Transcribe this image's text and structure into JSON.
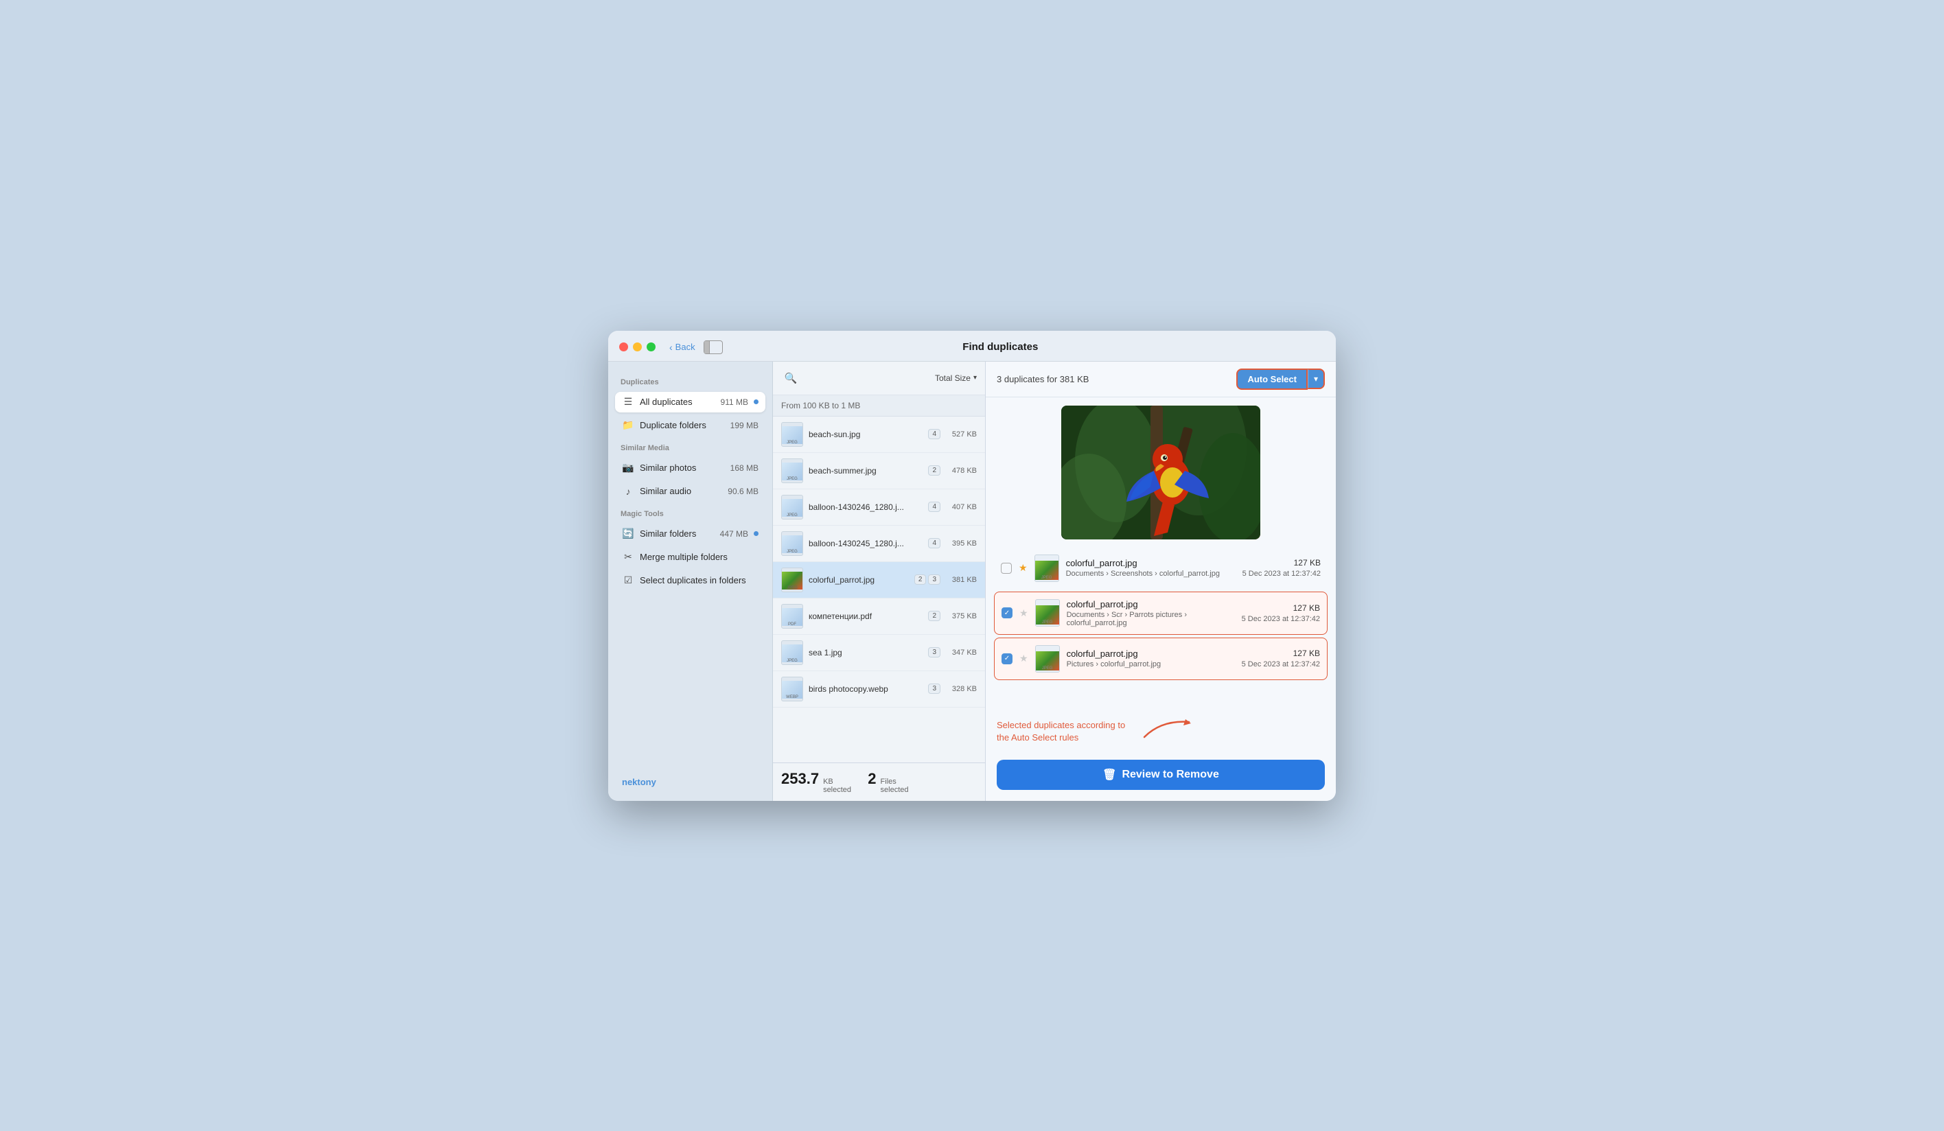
{
  "window": {
    "title": "Find duplicates",
    "back_label": "Back"
  },
  "sidebar": {
    "duplicates_section": "Duplicates",
    "all_duplicates": "All duplicates",
    "all_duplicates_size": "911 MB",
    "duplicate_folders": "Duplicate folders",
    "duplicate_folders_size": "199 MB",
    "similar_media_section": "Similar Media",
    "similar_photos": "Similar photos",
    "similar_photos_size": "168 MB",
    "similar_audio": "Similar audio",
    "similar_audio_size": "90.6 MB",
    "magic_tools_section": "Magic Tools",
    "similar_folders": "Similar folders",
    "similar_folders_size": "447 MB",
    "merge_folders": "Merge multiple folders",
    "select_dups_label": "Select duplicates in folders",
    "logo": "nektony"
  },
  "file_panel": {
    "sort_label": "Total Size",
    "range_label": "From 100 KB to 1 MB",
    "files": [
      {
        "name": "beach-sun.jpg",
        "badge1": "4",
        "size": "527 KB"
      },
      {
        "name": "beach-summer.jpg",
        "badge1": "2",
        "size": "478 KB"
      },
      {
        "name": "balloon-1430246_1280.j...",
        "badge1": "4",
        "size": "407 KB"
      },
      {
        "name": "balloon-1430245_1280.j...",
        "badge1": "4",
        "size": "395 KB"
      },
      {
        "name": "colorful_parrot.jpg",
        "badge1": "2",
        "badge2": "3",
        "size": "381 KB",
        "selected": true
      },
      {
        "name": "компетенции.pdf",
        "badge1": "2",
        "size": "375 KB"
      },
      {
        "name": "sea 1.jpg",
        "badge1": "3",
        "size": "347 KB"
      },
      {
        "name": "birds photocopy.webp",
        "badge1": "3",
        "size": "328 KB"
      }
    ],
    "footer_kb": "253.7",
    "footer_kb_unit": "KB",
    "footer_kb_sublabel": "selected",
    "footer_files": "2",
    "footer_files_unit": "Files",
    "footer_files_sublabel": "selected"
  },
  "detail_panel": {
    "dup_count_text": "3 duplicates for 381 KB",
    "auto_select_label": "Auto Select",
    "entries": [
      {
        "checked": false,
        "starred": true,
        "filename": "colorful_parrot.jpg",
        "path1": "Documents",
        "path2": "Screenshots",
        "path3": "colorful_parrot.jpg",
        "size": "127 KB",
        "date": "5 Dec 2023 at 12:37:42",
        "selected": false
      },
      {
        "checked": true,
        "starred": false,
        "filename": "colorful_parrot.jpg",
        "path1": "Documents",
        "path2": "Scr › Parrots pictures",
        "path3": "colorful_parrot.jpg",
        "size": "127 KB",
        "date": "5 Dec 2023 at 12:37:42",
        "selected": true
      },
      {
        "checked": true,
        "starred": false,
        "filename": "colorful_parrot.jpg",
        "path1": "Pictures",
        "path2": "colorful_parrot.jpg",
        "path3": "",
        "size": "127 KB",
        "date": "5 Dec 2023 at 12:37:42",
        "selected": true
      }
    ],
    "annotation": "Selected duplicates according\nto the Auto Select rules",
    "review_btn": "Review to Remove"
  }
}
